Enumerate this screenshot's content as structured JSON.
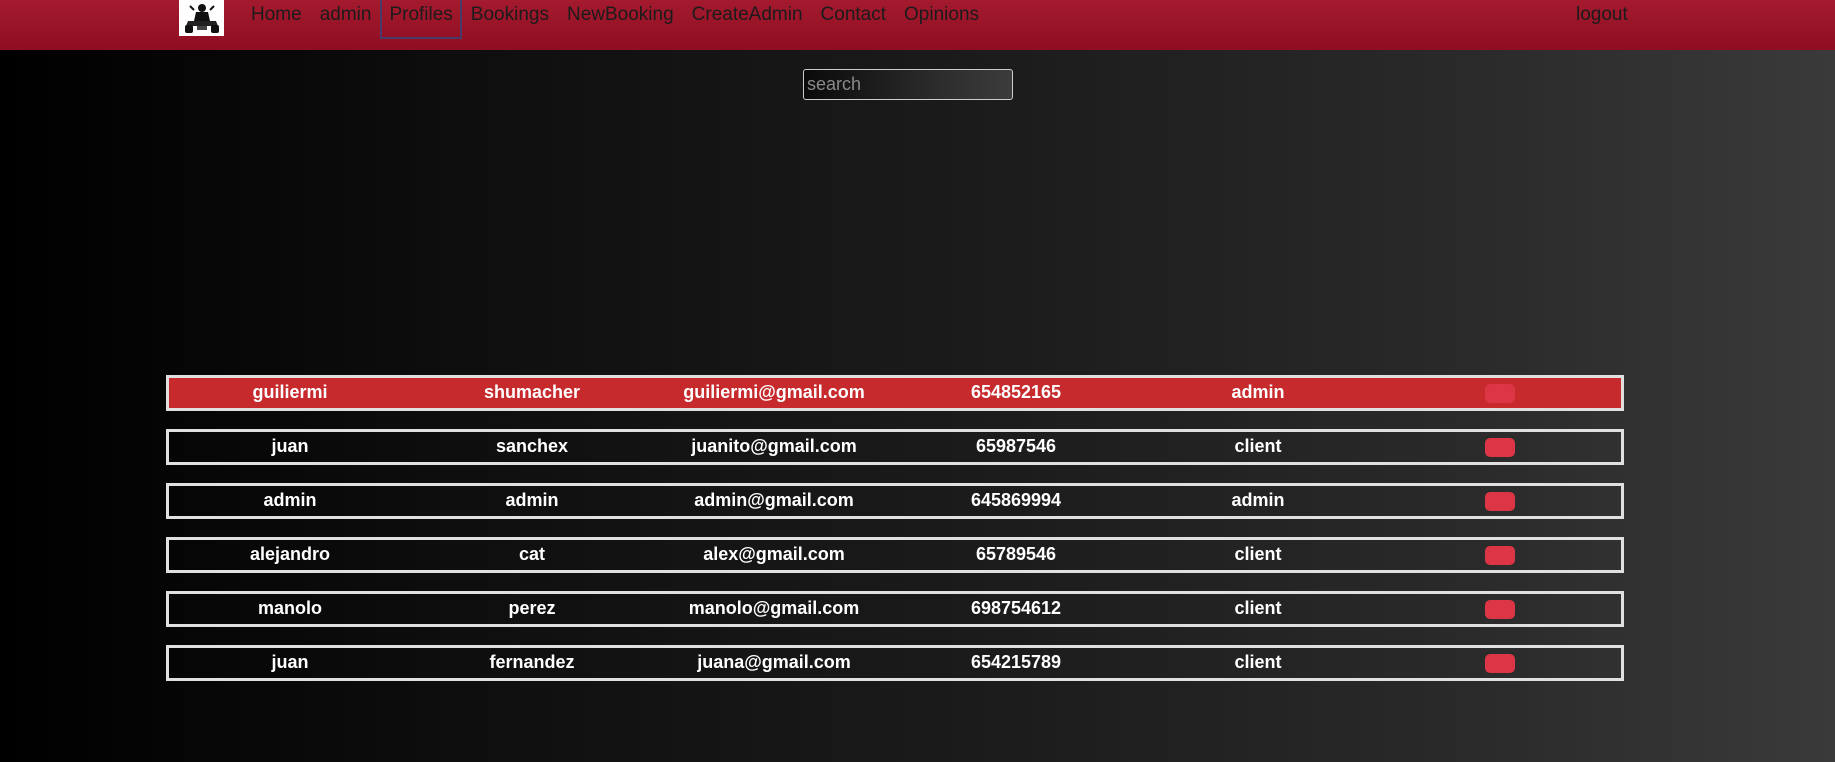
{
  "nav": {
    "links": [
      {
        "label": "Home"
      },
      {
        "label": "admin"
      },
      {
        "label": "Profiles"
      },
      {
        "label": "Bookings"
      },
      {
        "label": "NewBooking"
      },
      {
        "label": "CreateAdmin"
      },
      {
        "label": "Contact"
      },
      {
        "label": "Opinions"
      }
    ],
    "active": "Profiles",
    "logout_label": "logout"
  },
  "search": {
    "placeholder": "search",
    "value": ""
  },
  "users": [
    {
      "name": "guiliermi",
      "surname": "shumacher",
      "email": "guiliermi@gmail.com",
      "phone": "654852165",
      "role": "admin"
    },
    {
      "name": "juan",
      "surname": "sanchex",
      "email": "juanito@gmail.com",
      "phone": "65987546",
      "role": "client"
    },
    {
      "name": "admin",
      "surname": "admin",
      "email": "admin@gmail.com",
      "phone": "645869994",
      "role": "admin"
    },
    {
      "name": "alejandro",
      "surname": "cat",
      "email": "alex@gmail.com",
      "phone": "65789546",
      "role": "client"
    },
    {
      "name": "manolo",
      "surname": "perez",
      "email": "manolo@gmail.com",
      "phone": "698754612",
      "role": "client"
    },
    {
      "name": "juan",
      "surname": "fernandez",
      "email": "juana@gmail.com",
      "phone": "654215789",
      "role": "client"
    }
  ],
  "colors": {
    "navbar": "#9a1428",
    "highlight_row": "#c62a2d",
    "delete_button": "#dc3545",
    "row_border": "#e0e0e0"
  }
}
